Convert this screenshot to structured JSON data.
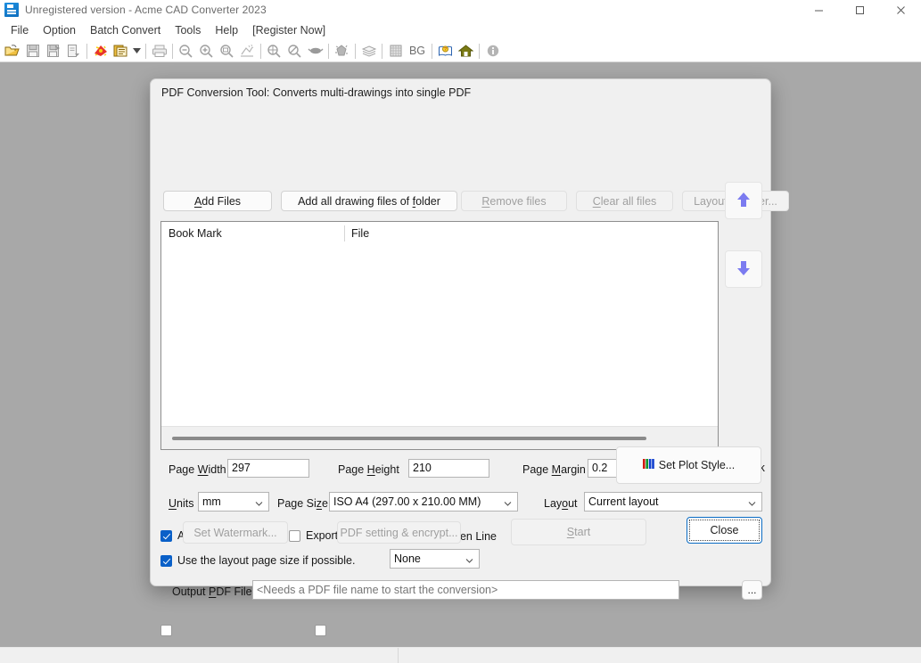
{
  "window": {
    "title": "Unregistered version - Acme CAD Converter 2023",
    "icon": "app-icon",
    "controls": {
      "minimize": "minimize-icon",
      "maximize": "maximize-icon",
      "close": "close-icon"
    }
  },
  "menubar": {
    "items": [
      {
        "label": "File"
      },
      {
        "label": "Option"
      },
      {
        "label": "Batch Convert"
      },
      {
        "label": "Tools"
      },
      {
        "label": "Help"
      },
      {
        "label": "[Register Now]"
      }
    ]
  },
  "toolbar": {
    "bg_label": "BG",
    "items": [
      {
        "name": "open-file-icon"
      },
      {
        "name": "save-icon"
      },
      {
        "name": "save-as-icon"
      },
      {
        "name": "export-icon"
      },
      {
        "sep": true
      },
      {
        "name": "pdf-convert-icon"
      },
      {
        "name": "batch-convert-icon"
      },
      {
        "name": "dropdown-arrow-icon"
      },
      {
        "sep": true
      },
      {
        "name": "print-icon"
      },
      {
        "sep": true
      },
      {
        "name": "zoom-out-icon"
      },
      {
        "name": "zoom-in-icon"
      },
      {
        "name": "zoom-window-icon"
      },
      {
        "name": "zoom-extent-icon"
      },
      {
        "sep": true
      },
      {
        "name": "zoom-all-icon"
      },
      {
        "name": "zoom-previous-icon"
      },
      {
        "name": "pan-icon"
      },
      {
        "sep": true
      },
      {
        "name": "render-icon"
      },
      {
        "sep": true
      },
      {
        "name": "layers-icon"
      },
      {
        "sep": true
      },
      {
        "name": "grid-icon"
      },
      {
        "name": "background-color-icon"
      },
      {
        "sep": true
      },
      {
        "name": "help-book-icon"
      },
      {
        "name": "home-icon"
      },
      {
        "sep": true
      },
      {
        "name": "info-icon"
      }
    ]
  },
  "dialog": {
    "title": "PDF Conversion Tool: Converts multi-drawings into single PDF",
    "buttons": {
      "add_files": "Add Files",
      "add_files_accel": "A",
      "add_folder": "Add all drawing files of folder",
      "remove_files": "Remove files",
      "clear_all_files": "Clear all files",
      "layout_layer": "Layout & Layer...",
      "move_up": "move-up-icon",
      "move_down": "move-down-icon",
      "plot_style": "Set Plot Style...",
      "browse": "...",
      "watermark": "Set Watermark...",
      "pdf_setting": "PDF setting & encrypt...",
      "start": "Start",
      "close": "Close"
    },
    "file_list": {
      "columns": [
        "Book Mark",
        "File"
      ],
      "rows": []
    },
    "fields": {
      "page_width_label": "Page Width",
      "page_width_value": "297",
      "page_height_label": "Page Height",
      "page_height_value": "210",
      "page_margin_label": "Page Margin",
      "page_margin_value": "0.2",
      "export_bookmark_label": "Export Bookmark",
      "export_bookmark_checked": true,
      "units_label": "Units",
      "units_value": "mm",
      "page_size_label": "Page Size",
      "page_size_value": "ISO A4 (297.00 x 210.00 MM)",
      "layout_label": "Layout",
      "layout_value": "Current layout",
      "auto_zoom_label": "Auto Zoom Extent",
      "auto_zoom_checked": true,
      "export_layer_label": "Export Layer",
      "export_layer_checked": false,
      "use_layout_size_label": "Use the layout page size if possible.",
      "use_layout_size_checked": true,
      "removes_hidden_line_label": "Removes Hidden Line",
      "removes_hidden_line_value": "None",
      "output_pdf_label": "Output PDF File",
      "output_pdf_value": "<Needs a PDF file name to start the conversion>",
      "watermark_checked": false,
      "pdf_setting_checked": false
    }
  },
  "statusbar": {
    "panel1": "",
    "panel2": ""
  },
  "colors": {
    "accent": "#0a60c8",
    "workspace": "#a8a8a8",
    "arrow": "#7b7bf0",
    "dialog_bg": "#f0f0f0"
  }
}
